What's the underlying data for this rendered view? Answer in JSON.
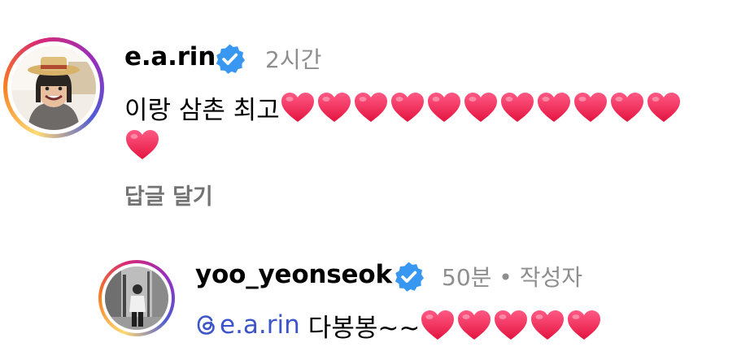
{
  "comments": [
    {
      "username": "e.a.rin",
      "verified": true,
      "time": "2시간",
      "text": "이랑 삼촌 최고",
      "hearts_line1": 11,
      "hearts_line2": 1,
      "reply_label": "답글 달기"
    },
    {
      "username": "yoo_yeonseok",
      "verified": true,
      "time": "50분 • 작성자",
      "mention": "e.a.rin",
      "text": "다봉봉~~",
      "hearts_line1": 5
    }
  ],
  "colors": {
    "verified_blue": "#3897f0",
    "heart": "#f2245b",
    "mention": "#3b55c8",
    "secondary_text": "#8e8e8e"
  },
  "icons": {
    "verified": "verified-badge-icon",
    "heart": "red-heart-emoji",
    "threads": "threads-icon"
  }
}
